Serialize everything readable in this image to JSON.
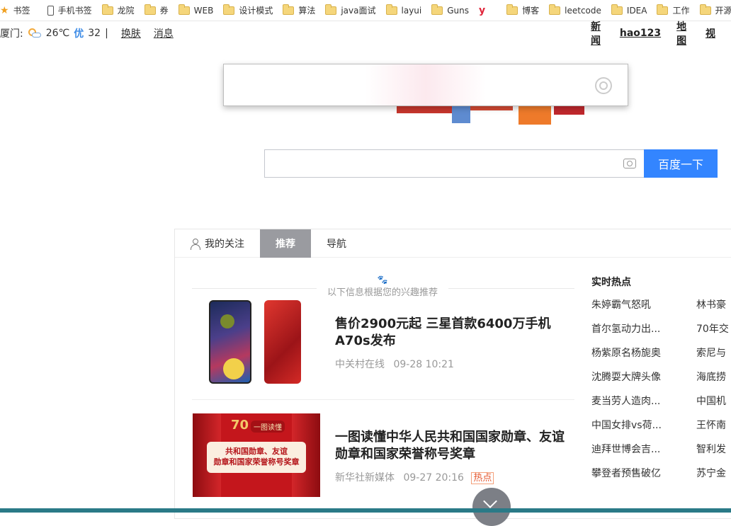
{
  "bookmarks": [
    {
      "label": "书签",
      "icon": "star-icon"
    },
    {
      "label": "手机书签",
      "icon": "phone-icon"
    },
    {
      "label": "龙院",
      "icon": "folder-icon"
    },
    {
      "label": "券",
      "icon": "folder-icon"
    },
    {
      "label": "WEB",
      "icon": "folder-icon"
    },
    {
      "label": "设计模式",
      "icon": "folder-icon"
    },
    {
      "label": "算法",
      "icon": "folder-icon"
    },
    {
      "label": "java面试",
      "icon": "folder-icon"
    },
    {
      "label": "layui",
      "icon": "folder-icon"
    },
    {
      "label": "Guns",
      "icon": "folder-icon"
    },
    {
      "label": "y",
      "icon": "y-logo-icon"
    },
    {
      "label": "博客",
      "icon": "folder-icon"
    },
    {
      "label": "leetcode",
      "icon": "folder-icon"
    },
    {
      "label": "IDEA",
      "icon": "folder-icon"
    },
    {
      "label": "工作",
      "icon": "folder-icon"
    },
    {
      "label": "开源项",
      "icon": "folder-icon"
    }
  ],
  "topbar": {
    "city": "厦门:",
    "temperature": "26℃",
    "aqi_label": "优",
    "aqi_value": "32",
    "divider": "|",
    "skin": "换肤",
    "messages": "消息",
    "nav": [
      "新闻",
      "hao123",
      "地图",
      "视"
    ]
  },
  "search": {
    "placeholder": "",
    "button": "百度一下"
  },
  "tabs": [
    "我的关注",
    "推荐",
    "导航"
  ],
  "feed": {
    "notice": "以下信息根据您的兴趣推荐",
    "items": [
      {
        "title": "售价2900元起 三星首款6400万手机A70s发布",
        "source": "中关村在线",
        "time": "09-28 10:21",
        "tag": ""
      },
      {
        "title": "一图读懂中华人民共和国国家勋章、友谊勋章和国家荣誉称号奖章",
        "source": "新华社新媒体",
        "time": "09-27 20:16",
        "tag": "热点"
      }
    ],
    "image2": {
      "badge_number": "70",
      "badge_tag": "一图读懂",
      "banner_line1": "共和国勋章、友谊",
      "banner_line2": "勋章和国家荣誉称号奖章"
    }
  },
  "hot": {
    "title": "实时热点",
    "items": [
      "朱婷霸气怒吼",
      "林书豪",
      "首尔氢动力出...",
      "70年交",
      "杨紫原名杨旎奥",
      "索尼与",
      "沈腾耍大牌头像",
      "海底捞",
      "麦当劳人造肉...",
      "中国机",
      "中国女排vs荷...",
      "王怀南",
      "迪拜世博会吉...",
      "智利发",
      "攀登者预售破亿",
      "苏宁金"
    ]
  }
}
